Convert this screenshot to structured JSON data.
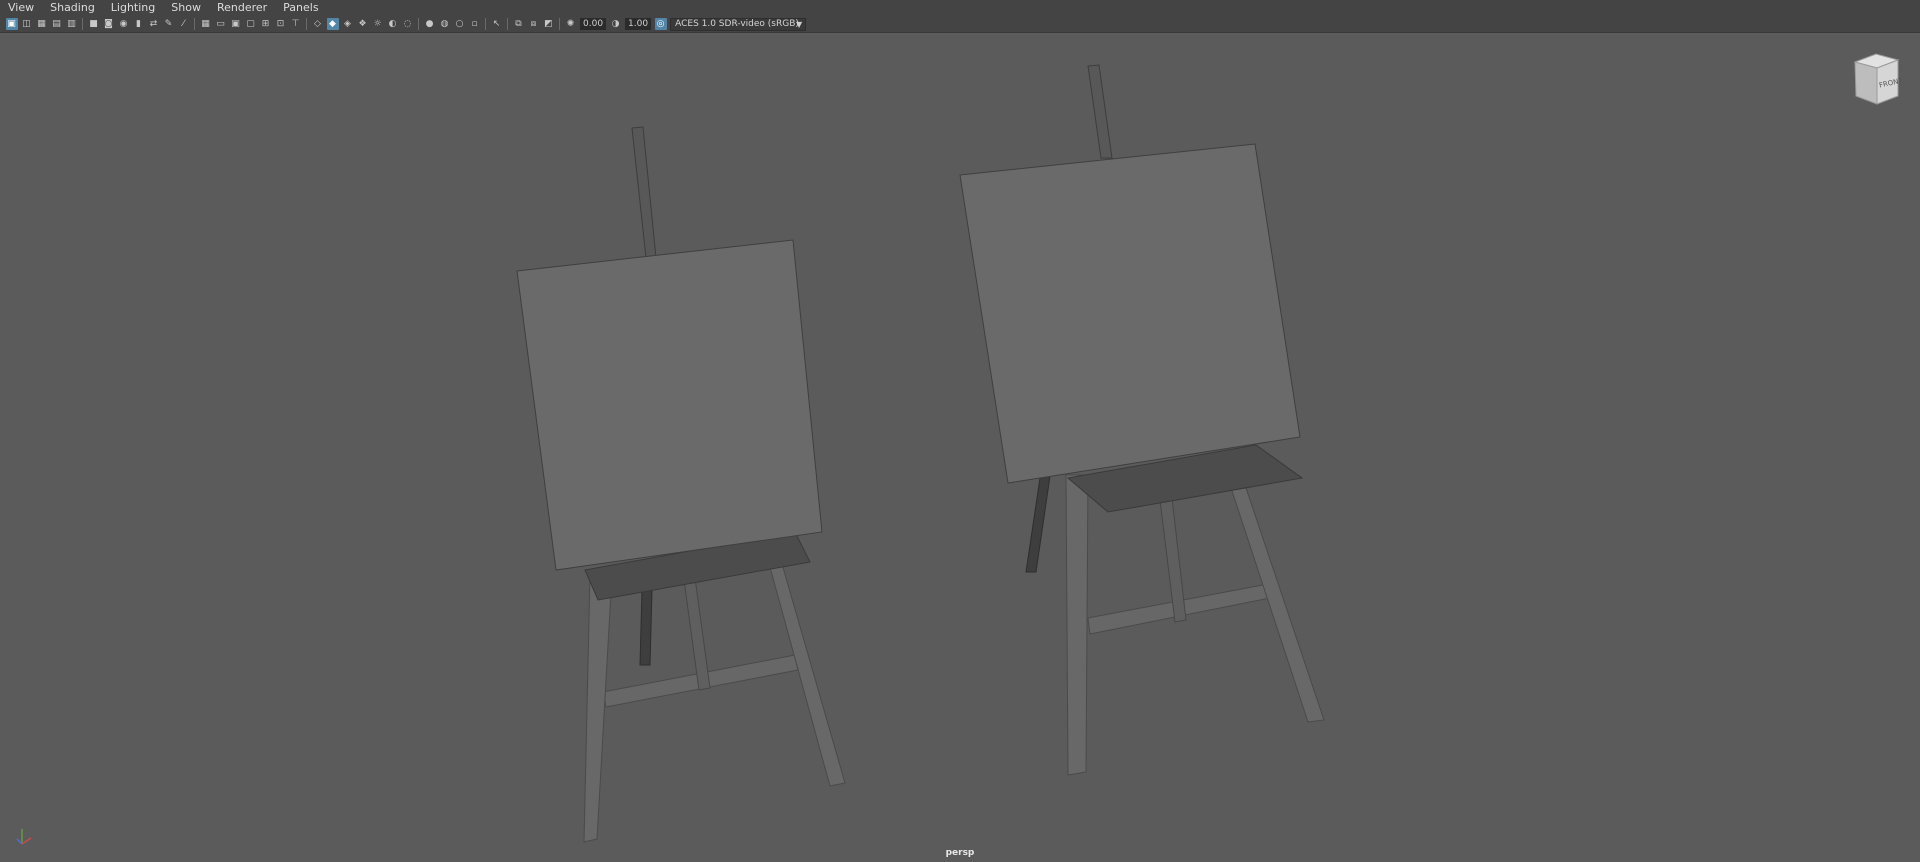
{
  "menubar": {
    "items": [
      {
        "label": "View"
      },
      {
        "label": "Shading"
      },
      {
        "label": "Lighting"
      },
      {
        "label": "Show"
      },
      {
        "label": "Renderer"
      },
      {
        "label": "Panels"
      }
    ]
  },
  "toolbar": {
    "exposure_value": "0.00",
    "gamma_value": "1.00",
    "color_space": "ACES 1.0 SDR-video (sRGB)",
    "colors": {
      "active_icon": "#5285a6",
      "bar": "#444444"
    }
  },
  "viewport": {
    "background": "#5b5b5b",
    "viewcube_label": "FRONT",
    "camera_label": "persp"
  }
}
